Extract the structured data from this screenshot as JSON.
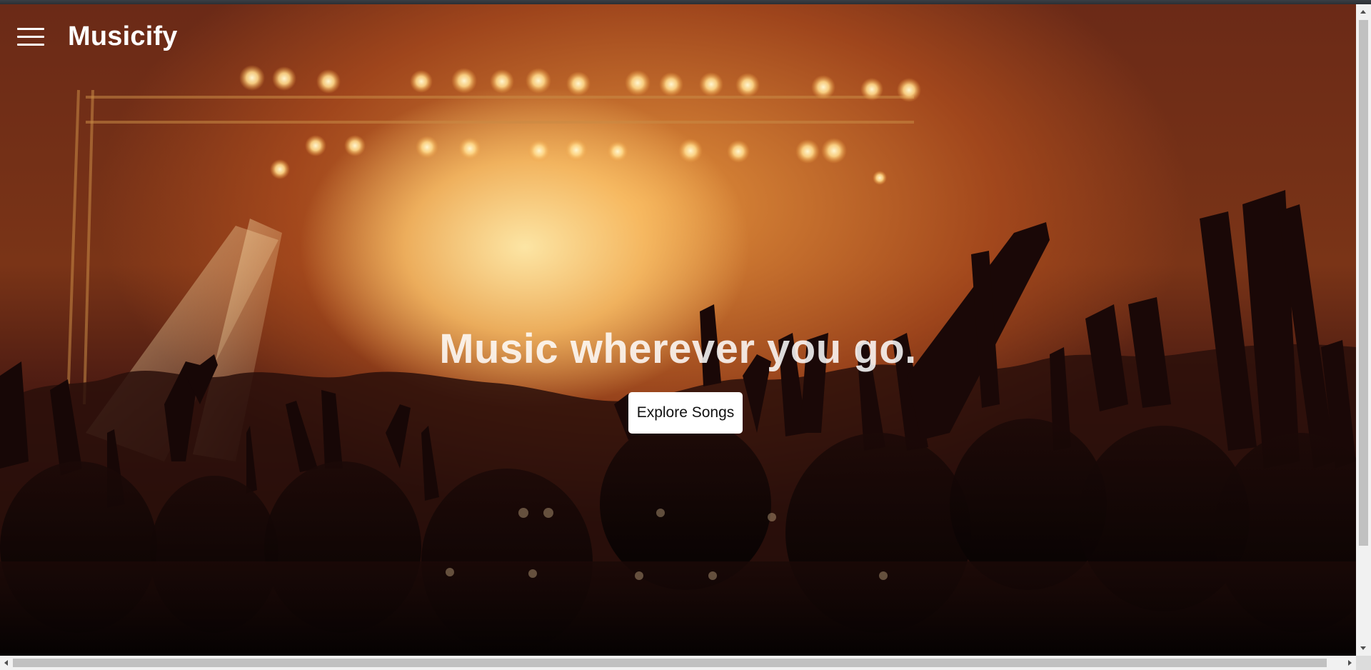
{
  "nav": {
    "brand": "Musicify",
    "menu_icon": "hamburger-menu-icon"
  },
  "hero": {
    "headline": "Music wherever you go.",
    "cta_label": "Explore Songs",
    "background_image": "concert-crowd-stage-lights-photo"
  },
  "colors": {
    "text": "#ffffff",
    "button_bg": "#ffffff",
    "button_text": "#111111",
    "stage_glow": "#f2b15a"
  }
}
